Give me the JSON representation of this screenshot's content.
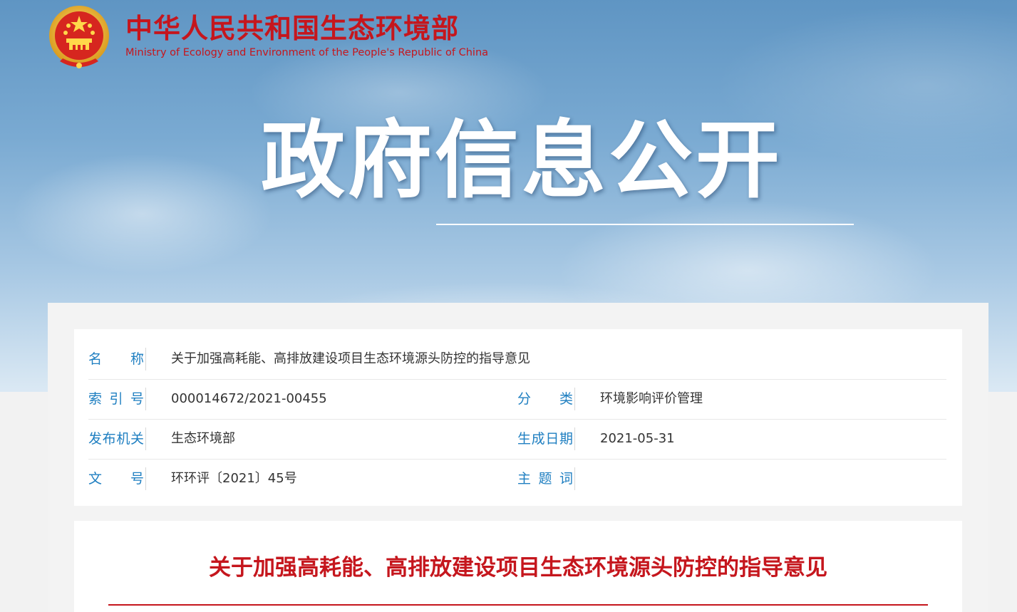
{
  "header": {
    "site_name_cn": "中华人民共和国生态环境部",
    "site_name_en": "Ministry of Ecology and Environment of the People's Republic of China",
    "emblem_icon": "national-emblem-icon",
    "brand_color": "#c5161d"
  },
  "banner": {
    "title": "政府信息公开"
  },
  "meta": {
    "label_color": "#1f7fc1",
    "name": {
      "label": "名　　称",
      "value": "关于加强高耗能、高排放建设项目生态环境源头防控的指导意见"
    },
    "index_no": {
      "label": "索 引 号",
      "value": "000014672/2021-00455"
    },
    "category": {
      "label": "分　　类",
      "value": "环境影响评价管理"
    },
    "issuer": {
      "label": "发布机关",
      "value": "生态环境部"
    },
    "date": {
      "label": "生成日期",
      "value": "2021-05-31"
    },
    "doc_no": {
      "label": "文　　号",
      "value": "环环评〔2021〕45号"
    },
    "keywords": {
      "label": "主 题 词",
      "value": ""
    }
  },
  "article": {
    "title": "关于加强高耗能、高排放建设项目生态环境源头防控的指导意见"
  }
}
